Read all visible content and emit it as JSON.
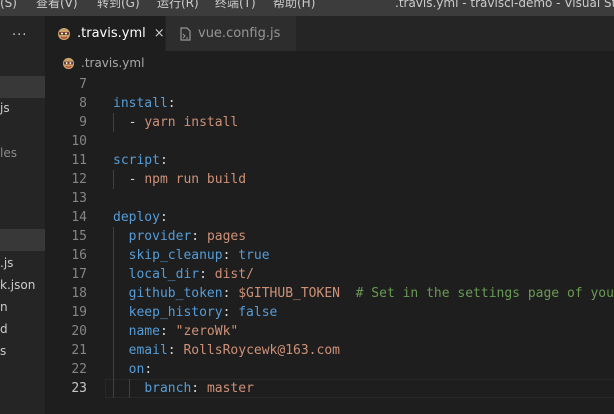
{
  "window": {
    "title": ".travis.yml - travisci-demo - Visual Studio C"
  },
  "menu": {
    "items": [
      "(S)",
      "查看(V)",
      "转到(G)",
      "运行(R)",
      "终端(T)",
      "帮助(H)"
    ]
  },
  "sidebar": {
    "more": "···",
    "items": [
      {
        "label": "js"
      },
      {
        "label": "les"
      },
      {
        "label": ".js"
      },
      {
        "label": "k.json"
      },
      {
        "label": "n"
      },
      {
        "label": "d"
      },
      {
        "label": "s"
      }
    ]
  },
  "tabs": [
    {
      "label": ".travis.yml",
      "close": "×"
    },
    {
      "label": "vue.config.js"
    }
  ],
  "breadcrumb": {
    "file": ".travis.yml"
  },
  "editor": {
    "current_line": 23,
    "lines": [
      {
        "n": "7",
        "tokens": []
      },
      {
        "n": "8",
        "tokens": [
          {
            "t": "install",
            "c": "k"
          },
          {
            "t": ":",
            "c": "p"
          }
        ]
      },
      {
        "n": "9",
        "tokens": [
          {
            "t": "  - ",
            "c": "p"
          },
          {
            "t": "yarn install",
            "c": "s"
          }
        ]
      },
      {
        "n": "10",
        "tokens": []
      },
      {
        "n": "11",
        "tokens": [
          {
            "t": "script",
            "c": "k"
          },
          {
            "t": ":",
            "c": "p"
          }
        ]
      },
      {
        "n": "12",
        "tokens": [
          {
            "t": "  - ",
            "c": "p"
          },
          {
            "t": "npm run build",
            "c": "s"
          }
        ]
      },
      {
        "n": "13",
        "tokens": []
      },
      {
        "n": "14",
        "tokens": [
          {
            "t": "deploy",
            "c": "k"
          },
          {
            "t": ":",
            "c": "p"
          }
        ]
      },
      {
        "n": "15",
        "tokens": [
          {
            "t": "  ",
            "c": "p"
          },
          {
            "t": "provider",
            "c": "k"
          },
          {
            "t": ": ",
            "c": "p"
          },
          {
            "t": "pages",
            "c": "s"
          }
        ]
      },
      {
        "n": "16",
        "tokens": [
          {
            "t": "  ",
            "c": "p"
          },
          {
            "t": "skip_cleanup",
            "c": "k"
          },
          {
            "t": ": ",
            "c": "p"
          },
          {
            "t": "true",
            "c": "b"
          }
        ]
      },
      {
        "n": "17",
        "tokens": [
          {
            "t": "  ",
            "c": "p"
          },
          {
            "t": "local_dir",
            "c": "k"
          },
          {
            "t": ": ",
            "c": "p"
          },
          {
            "t": "dist/",
            "c": "s"
          }
        ]
      },
      {
        "n": "18",
        "tokens": [
          {
            "t": "  ",
            "c": "p"
          },
          {
            "t": "github_token",
            "c": "k"
          },
          {
            "t": ": ",
            "c": "p"
          },
          {
            "t": "$GITHUB_TOKEN",
            "c": "s"
          },
          {
            "t": "  ",
            "c": "p"
          },
          {
            "t": "# Set in the settings page of your",
            "c": "c"
          }
        ]
      },
      {
        "n": "19",
        "tokens": [
          {
            "t": "  ",
            "c": "p"
          },
          {
            "t": "keep_history",
            "c": "k"
          },
          {
            "t": ": ",
            "c": "p"
          },
          {
            "t": "false",
            "c": "b"
          }
        ]
      },
      {
        "n": "20",
        "tokens": [
          {
            "t": "  ",
            "c": "p"
          },
          {
            "t": "name",
            "c": "k"
          },
          {
            "t": ": ",
            "c": "p"
          },
          {
            "t": "\"zeroWk\"",
            "c": "s"
          }
        ]
      },
      {
        "n": "21",
        "tokens": [
          {
            "t": "  ",
            "c": "p"
          },
          {
            "t": "email",
            "c": "k"
          },
          {
            "t": ": ",
            "c": "p"
          },
          {
            "t": "RollsRoycewk@163.com",
            "c": "s"
          }
        ]
      },
      {
        "n": "22",
        "tokens": [
          {
            "t": "  ",
            "c": "p"
          },
          {
            "t": "on",
            "c": "k"
          },
          {
            "t": ":",
            "c": "p"
          }
        ]
      },
      {
        "n": "23",
        "tokens": [
          {
            "t": "    ",
            "c": "p"
          },
          {
            "t": "branch",
            "c": "k"
          },
          {
            "t": ": ",
            "c": "p"
          },
          {
            "t": "master",
            "c": "s"
          }
        ]
      }
    ]
  },
  "colors": {
    "editor_bg": "#1e1e1e",
    "sidebar_bg": "#252526",
    "key": "#569cd6",
    "string": "#ce9178",
    "comment": "#6a9955",
    "line_number": "#858585"
  }
}
